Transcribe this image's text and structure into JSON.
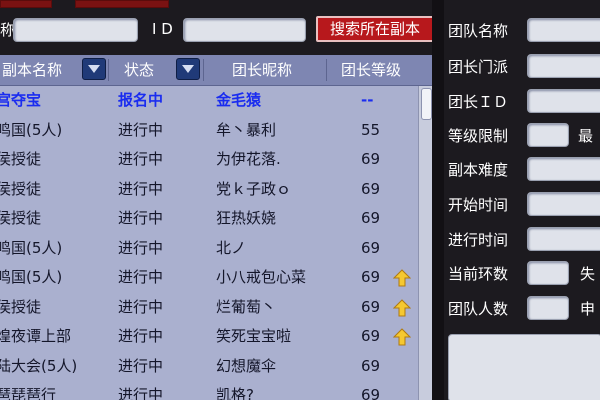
{
  "top": {
    "label_name_partial": "称",
    "label_id": "I D",
    "search_button": "搜索所在副本"
  },
  "table": {
    "headers": [
      "副本名称",
      "状态",
      "团长昵称",
      "团长等级"
    ],
    "rows": [
      {
        "name": "宫夺宝",
        "status": "报名中",
        "leader": "金毛猿",
        "level": "--",
        "up": false
      },
      {
        "name": "鸣国(5人)",
        "status": "进行中",
        "leader": "牟丶暴利",
        "level": "55",
        "up": false
      },
      {
        "name": "侯授徒",
        "status": "进行中",
        "leader": "为伊花落.",
        "level": "69",
        "up": false
      },
      {
        "name": "侯授徒",
        "status": "进行中",
        "leader": "党ｋ子政ｏ",
        "level": "69",
        "up": false
      },
      {
        "name": "侯授徒",
        "status": "进行中",
        "leader": "狂热妖娆",
        "level": "69",
        "up": false
      },
      {
        "name": "鸣国(5人)",
        "status": "进行中",
        "leader": "北ノ",
        "level": "69",
        "up": false
      },
      {
        "name": "鸣国(5人)",
        "status": "进行中",
        "leader": "小八戒包心菜",
        "level": "69",
        "up": true
      },
      {
        "name": "侯授徒",
        "status": "进行中",
        "leader": "烂葡萄丶",
        "level": "69",
        "up": true
      },
      {
        "name": "煌夜谭上部",
        "status": "进行中",
        "leader": "笑死宝宝啦",
        "level": "69",
        "up": true
      },
      {
        "name": "陆大会(5人)",
        "status": "进行中",
        "leader": "幻想魔伞",
        "level": "69",
        "up": false
      },
      {
        "name": "琶琵琶行",
        "status": "进行中",
        "leader": "凯格?",
        "level": "69",
        "up": false
      }
    ]
  },
  "panel": {
    "team_name": "团队名称",
    "leader_sect": "团长门派",
    "leader_id": "团长ＩＤ",
    "level_limit": "等级限制",
    "level_max_partial": "最",
    "difficulty": "副本难度",
    "start_time": "开始时间",
    "elapsed_time": "进行时间",
    "current_round": "当前环数",
    "fail_partial": "失",
    "team_size": "团队人数",
    "apply_partial": "申"
  },
  "colors": {
    "accent_red": "#b7181c",
    "header_blue": "#7e86b2",
    "row_bg": "#aab0cf",
    "first_row_text": "#1a2cf0"
  }
}
